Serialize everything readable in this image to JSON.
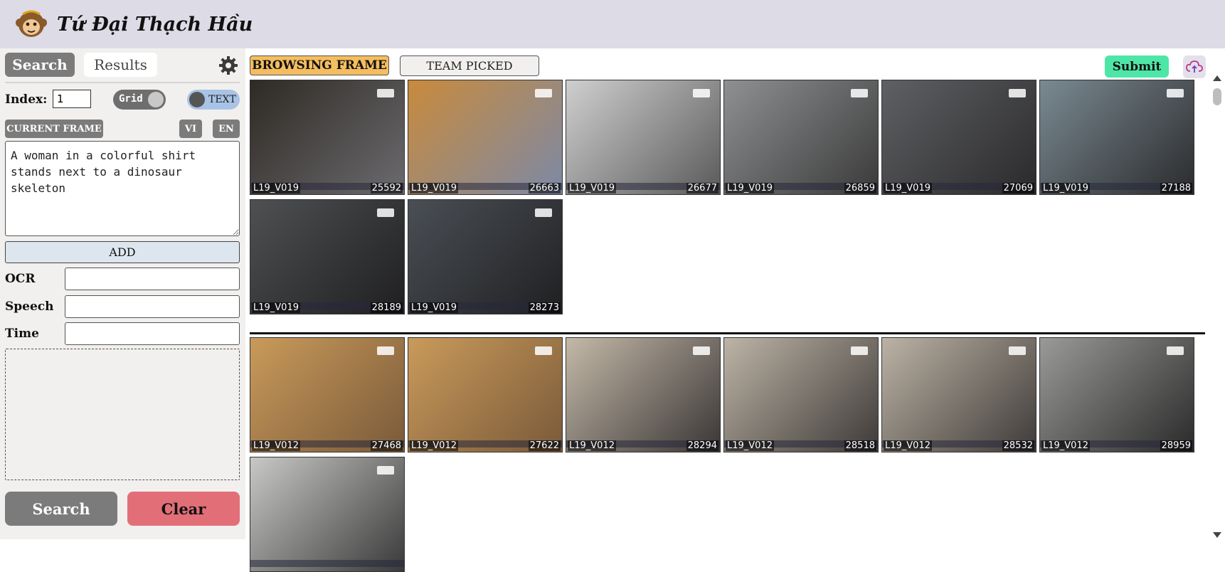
{
  "header": {
    "title": "Tứ Đại Thạch Hầu",
    "logo_icon": "monkey-logo-icon"
  },
  "sidebar": {
    "tabs": {
      "search": "Search",
      "results": "Results"
    },
    "index_label": "Index:",
    "index_value": "1",
    "grid_toggle_label": "Grid",
    "text_toggle_label": "TEXT",
    "current_frame_label": "CURRENT FRAME",
    "lang_vi": "VI",
    "lang_en": "EN",
    "query_text": "A woman in a colorful shirt stands next to a dinosaur skeleton",
    "add_label": "ADD",
    "fields": {
      "ocr": "OCR",
      "speech": "Speech",
      "time": "Time"
    },
    "search_button": "Search",
    "clear_button": "Clear"
  },
  "toolbar": {
    "browsing_frame": "BROWSING FRAME",
    "team_picked": "TEAM PICKED",
    "submit": "Submit"
  },
  "group1": [
    {
      "id": "L19_V019",
      "frame": "25592",
      "colors": [
        "#2e2a24",
        "#6b6a6e"
      ]
    },
    {
      "id": "L19_V019",
      "frame": "26663",
      "colors": [
        "#c98a3c",
        "#7c89a6"
      ]
    },
    {
      "id": "L19_V019",
      "frame": "26677",
      "colors": [
        "#cfcfcf",
        "#5a5a5a"
      ]
    },
    {
      "id": "L19_V019",
      "frame": "26859",
      "colors": [
        "#8e9092",
        "#3a3a3a"
      ]
    },
    {
      "id": "L19_V019",
      "frame": "27069",
      "colors": [
        "#5f6063",
        "#2a2a2c"
      ]
    },
    {
      "id": "L19_V019",
      "frame": "27188",
      "colors": [
        "#7a8a92",
        "#2b2b2d"
      ]
    },
    {
      "id": "L19_V019",
      "frame": "28189",
      "colors": [
        "#4e5052",
        "#1f1f21"
      ]
    },
    {
      "id": "L19_V019",
      "frame": "28273",
      "colors": [
        "#4a4f55",
        "#202022"
      ]
    }
  ],
  "group2": [
    {
      "id": "L19_V012",
      "frame": "27468",
      "colors": [
        "#c99a5a",
        "#7a5a3a"
      ]
    },
    {
      "id": "L19_V012",
      "frame": "27622",
      "colors": [
        "#c99a5a",
        "#7a5a3a"
      ]
    },
    {
      "id": "L19_V012",
      "frame": "28294",
      "colors": [
        "#c4b9a8",
        "#3a3636"
      ]
    },
    {
      "id": "L19_V012",
      "frame": "28518",
      "colors": [
        "#bdb4a6",
        "#3e3a38"
      ]
    },
    {
      "id": "L19_V012",
      "frame": "28532",
      "colors": [
        "#bcb3a5",
        "#3f3b39"
      ]
    },
    {
      "id": "L19_V012",
      "frame": "28959",
      "colors": [
        "#9a9a98",
        "#2a2a2a"
      ]
    },
    {
      "id": "",
      "frame": "",
      "colors": [
        "#c8c8c6",
        "#3a3a3a"
      ]
    }
  ]
}
